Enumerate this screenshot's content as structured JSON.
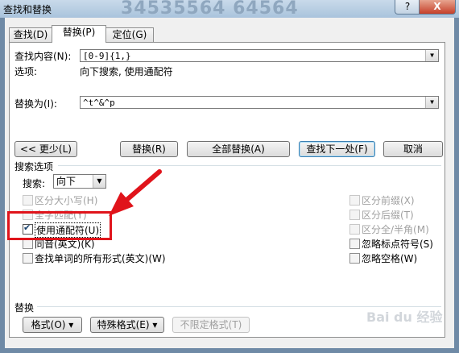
{
  "window": {
    "title": "查找和替换",
    "watermark": "34535564 64564",
    "help_label": "?",
    "close_label": "X"
  },
  "tabs": [
    {
      "label": "查找(D)"
    },
    {
      "label": "替换(P)"
    },
    {
      "label": "定位(G)"
    }
  ],
  "find": {
    "label": "查找内容(N):",
    "value": "[0-9]{1,}",
    "options_label": "选项:",
    "options_value": "向下搜索, 使用通配符"
  },
  "replace": {
    "label": "替换为(I):",
    "value": "^t^&^p"
  },
  "buttons": {
    "less": "<< 更少(L)",
    "replace": "替换(R)",
    "replace_all": "全部替换(A)",
    "find_next": "查找下一处(F)",
    "cancel": "取消"
  },
  "search_options": {
    "title": "搜索选项",
    "search_label": "搜索:",
    "search_value": "向下",
    "left": [
      {
        "label": "区分大小写(H)",
        "checked": false,
        "disabled": true
      },
      {
        "label": "全字匹配(Y)",
        "checked": false,
        "disabled": true
      },
      {
        "label": "使用通配符(U)",
        "checked": true,
        "disabled": false
      },
      {
        "label": "同音(英文)(K)",
        "checked": false,
        "disabled": false
      },
      {
        "label": "查找单词的所有形式(英文)(W)",
        "checked": false,
        "disabled": false
      }
    ],
    "right": [
      {
        "label": "区分前缀(X)",
        "checked": false,
        "disabled": true
      },
      {
        "label": "区分后缀(T)",
        "checked": false,
        "disabled": true
      },
      {
        "label": "区分全/半角(M)",
        "checked": false,
        "disabled": true
      },
      {
        "label": "忽略标点符号(S)",
        "checked": false,
        "disabled": false
      },
      {
        "label": "忽略空格(W)",
        "checked": false,
        "disabled": false
      }
    ]
  },
  "replace_section": {
    "title": "替换",
    "format": "格式(O) ▾",
    "special": "特殊格式(E) ▾",
    "no_format": "不限定格式(T)"
  },
  "colors": {
    "highlight": "#e0141b",
    "title_bar": "#b9cfe4"
  }
}
